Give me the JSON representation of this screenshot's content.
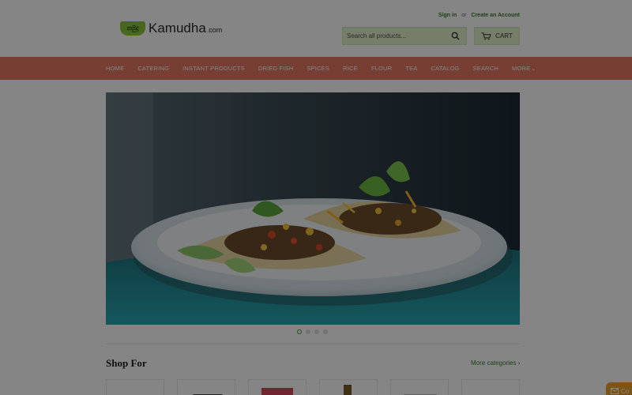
{
  "header": {
    "logo_mark_text": "කමුද",
    "logo_text": "Kamudha",
    "logo_sub": ".com",
    "sign_in": "Sign in",
    "or": "or",
    "create_account": "Create an Account",
    "search_placeholder": "Search all products...",
    "cart_label": "CART"
  },
  "nav": {
    "items": [
      "HOME",
      "CATERING",
      "INSTANT PRODUCTS",
      "DRIED FISH",
      "SPICES",
      "RICE",
      "FLOUR",
      "TEA",
      "CATALOG",
      "SEARCH"
    ],
    "more_label": "MORE"
  },
  "slider": {
    "active_index": 0,
    "count": 4
  },
  "section": {
    "title": "Shop For",
    "more_link": "More categories ›"
  },
  "chat": {
    "label": "Co"
  },
  "colors": {
    "nav_bg": "#e47865",
    "accent_green": "#3b7d2a",
    "search_bg": "#dff2c9",
    "chat_bg": "#f0a12a"
  }
}
